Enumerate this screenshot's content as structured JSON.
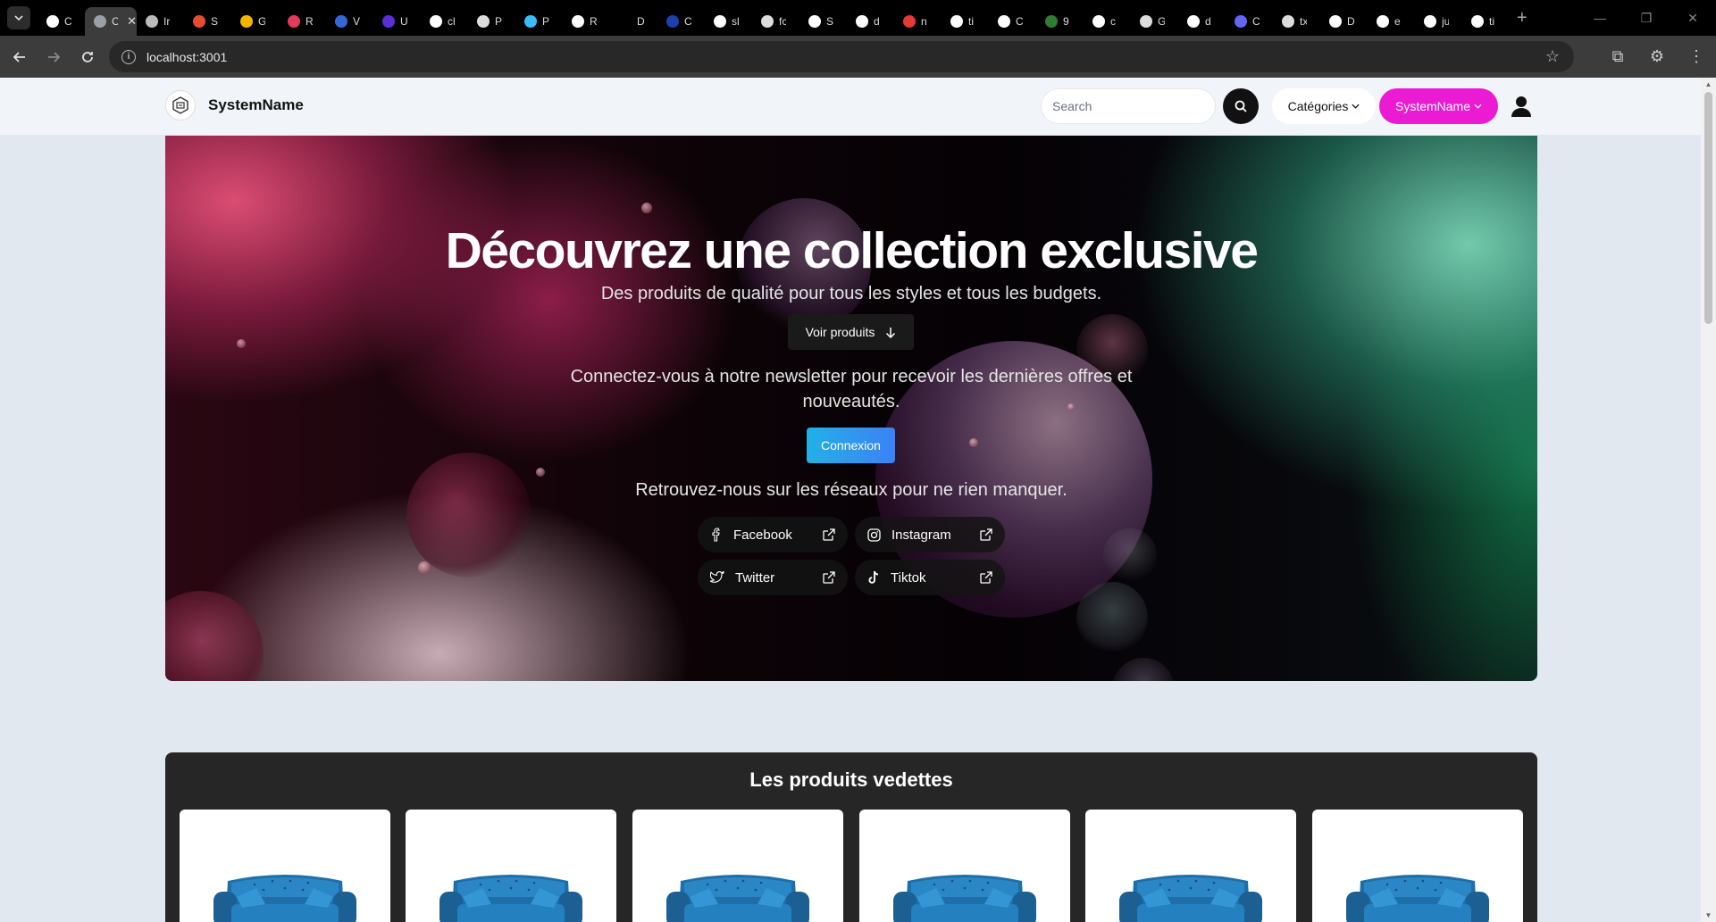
{
  "browser": {
    "url": "localhost:3001",
    "tabs": [
      {
        "label": "C",
        "color": "#ffffff"
      },
      {
        "label": "C",
        "color": "#9aa0a6",
        "active": true
      },
      {
        "label": "Ir",
        "color": "#bbbbbb"
      },
      {
        "label": "S",
        "color": "#e54d2e"
      },
      {
        "label": "G",
        "color": "#f4b400"
      },
      {
        "label": "R",
        "color": "#e23a5b"
      },
      {
        "label": "V",
        "color": "#3367d6"
      },
      {
        "label": "U",
        "color": "#5b2fd6"
      },
      {
        "label": "cl",
        "color": "#ffffff"
      },
      {
        "label": "P",
        "color": "#dddddd"
      },
      {
        "label": "P",
        "color": "#38bdf8"
      },
      {
        "label": "R",
        "color": "#ffffff"
      },
      {
        "label": "D",
        "color": "#000000"
      },
      {
        "label": "C",
        "color": "#1e40af"
      },
      {
        "label": "sl",
        "color": "#ffffff"
      },
      {
        "label": "fc",
        "color": "#dddddd"
      },
      {
        "label": "S",
        "color": "#ffffff"
      },
      {
        "label": "d",
        "color": "#ffffff"
      },
      {
        "label": "n",
        "color": "#e53935"
      },
      {
        "label": "ti",
        "color": "#ffffff"
      },
      {
        "label": "C",
        "color": "#ffffff"
      },
      {
        "label": "9",
        "color": "#2e7d32"
      },
      {
        "label": "c",
        "color": "#ffffff"
      },
      {
        "label": "G",
        "color": "#dddddd"
      },
      {
        "label": "d",
        "color": "#ffffff"
      },
      {
        "label": "C",
        "color": "#6366f1"
      },
      {
        "label": "tx",
        "color": "#dddddd"
      },
      {
        "label": "D",
        "color": "#ffffff"
      },
      {
        "label": "e",
        "color": "#ffffff"
      },
      {
        "label": "ju",
        "color": "#ffffff"
      },
      {
        "label": "ti",
        "color": "#ffffff"
      }
    ]
  },
  "header": {
    "brand_name": "SystemName",
    "search_placeholder": "Search",
    "categories_label": "Catégories",
    "account_label": "SystemName",
    "accent_color": "#ea1bd3"
  },
  "hero": {
    "title": "Découvrez une collection exclusive",
    "subtitle": "Des produits de qualité pour tous les styles et tous les budgets.",
    "voir_label": "Voir produits",
    "newsletter_text": "Connectez-vous à notre newsletter pour recevoir les dernières offres et nouveautés.",
    "connexion_label": "Connexion",
    "socials_text": "Retrouvez-nous sur les réseaux pour ne rien manquer.",
    "socials": {
      "facebook": "Facebook",
      "instagram": "Instagram",
      "twitter": "Twitter",
      "tiktok": "Tiktok"
    }
  },
  "featured": {
    "title": "Les produits vedettes",
    "product_count": 6
  }
}
